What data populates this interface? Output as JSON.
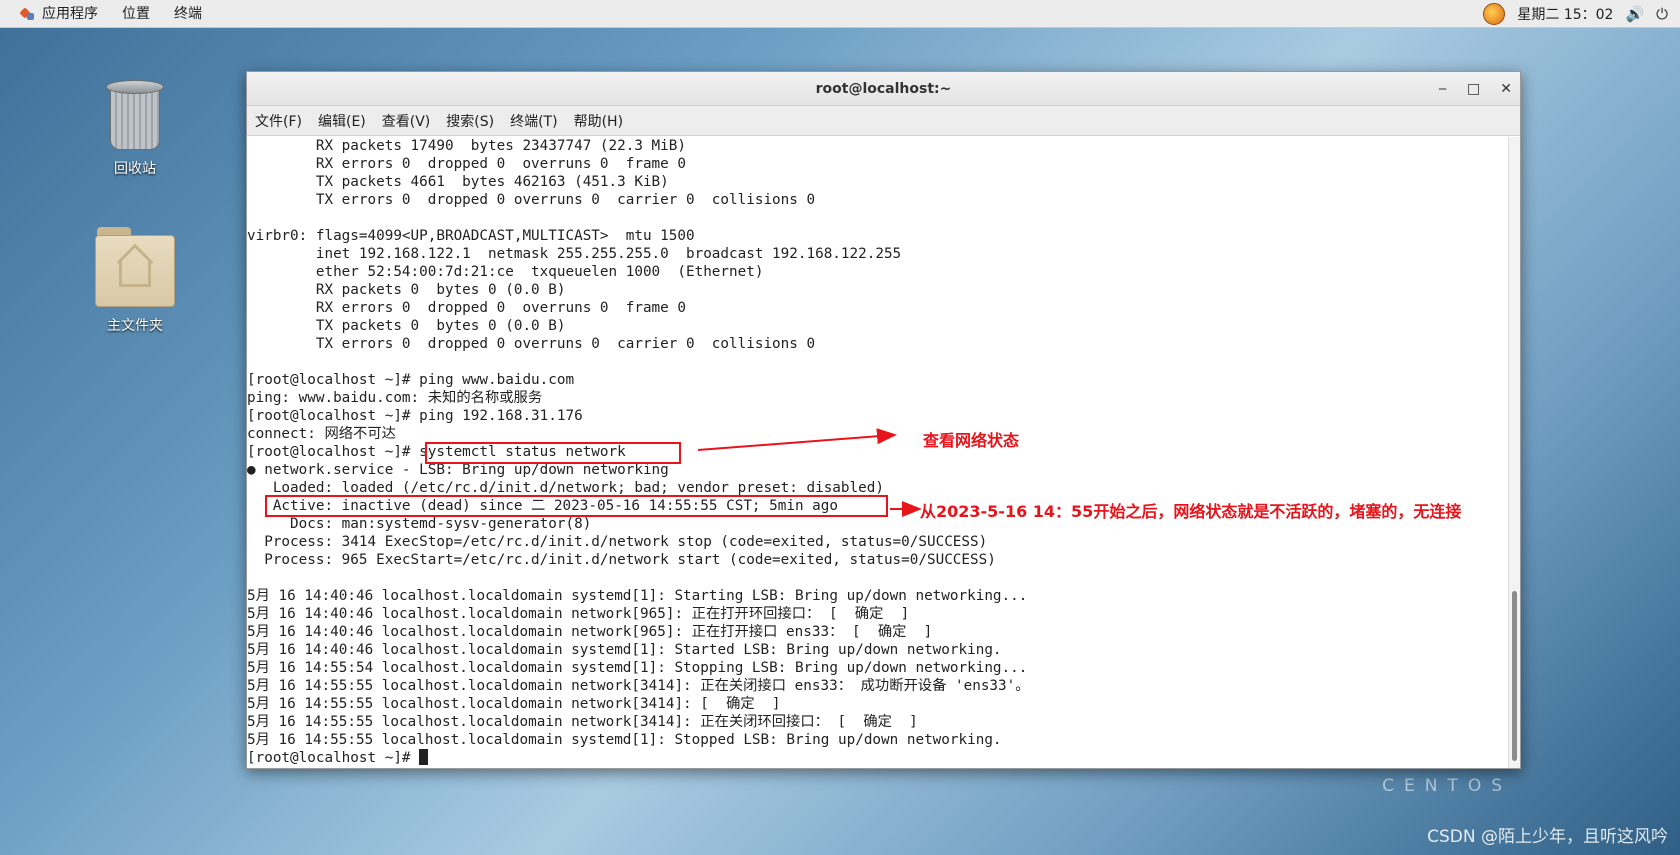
{
  "topbar": {
    "menu": [
      "应用程序",
      "位置",
      "终端"
    ],
    "clock": "星期二 15：02",
    "volume_symbol": "🔊",
    "power_symbol": "⏻"
  },
  "desktop": {
    "trash_label": "回收站",
    "home_label": "主文件夹",
    "brand": "CENTOS",
    "watermark": "CSDN @陌上少年，且听这风吟"
  },
  "window": {
    "title": "root@localhost:~",
    "minimize": "‒",
    "maximize": "□",
    "close": "✕",
    "menu": [
      "文件(F)",
      "编辑(E)",
      "查看(V)",
      "搜索(S)",
      "终端(T)",
      "帮助(H)"
    ]
  },
  "terminal": {
    "lines": [
      "        RX packets 17490  bytes 23437747 (22.3 MiB)",
      "        RX errors 0  dropped 0  overruns 0  frame 0",
      "        TX packets 4661  bytes 462163 (451.3 KiB)",
      "        TX errors 0  dropped 0 overruns 0  carrier 0  collisions 0",
      "",
      "virbr0: flags=4099<UP,BROADCAST,MULTICAST>  mtu 1500",
      "        inet 192.168.122.1  netmask 255.255.255.0  broadcast 192.168.122.255",
      "        ether 52:54:00:7d:21:ce  txqueuelen 1000  (Ethernet)",
      "        RX packets 0  bytes 0 (0.0 B)",
      "        RX errors 0  dropped 0  overruns 0  frame 0",
      "        TX packets 0  bytes 0 (0.0 B)",
      "        TX errors 0  dropped 0 overruns 0  carrier 0  collisions 0",
      "",
      "[root@localhost ~]# ping www.baidu.com",
      "ping: www.baidu.com: 未知的名称或服务",
      "[root@localhost ~]# ping 192.168.31.176",
      "connect: 网络不可达",
      "[root@localhost ~]# systemctl status network",
      "● network.service - LSB: Bring up/down networking",
      "   Loaded: loaded (/etc/rc.d/init.d/network; bad; vendor preset: disabled)",
      "   Active: inactive (dead) since 二 2023-05-16 14:55:55 CST; 5min ago",
      "     Docs: man:systemd-sysv-generator(8)",
      "  Process: 3414 ExecStop=/etc/rc.d/init.d/network stop (code=exited, status=0/SUCCESS)",
      "  Process: 965 ExecStart=/etc/rc.d/init.d/network start (code=exited, status=0/SUCCESS)",
      "",
      "5月 16 14:40:46 localhost.localdomain systemd[1]: Starting LSB: Bring up/down networking...",
      "5月 16 14:40:46 localhost.localdomain network[965]: 正在打开环回接口： [  确定  ]",
      "5月 16 14:40:46 localhost.localdomain network[965]: 正在打开接口 ens33： [  确定  ]",
      "5月 16 14:40:46 localhost.localdomain systemd[1]: Started LSB: Bring up/down networking.",
      "5月 16 14:55:54 localhost.localdomain systemd[1]: Stopping LSB: Bring up/down networking...",
      "5月 16 14:55:55 localhost.localdomain network[3414]: 正在关闭接口 ens33： 成功断开设备 'ens33'。",
      "5月 16 14:55:55 localhost.localdomain network[3414]: [  确定  ]",
      "5月 16 14:55:55 localhost.localdomain network[3414]: 正在关闭环回接口： [  确定  ]",
      "5月 16 14:55:55 localhost.localdomain systemd[1]: Stopped LSB: Bring up/down networking."
    ],
    "prompt": "[root@localhost ~]# "
  },
  "annotations": {
    "status_note": "查看网络状态",
    "inactive_note": "从2023-5-16 14：55开始之后，网络状态就是不活跃的，堵塞的，无连接",
    "accent_color": "#e8141b"
  }
}
